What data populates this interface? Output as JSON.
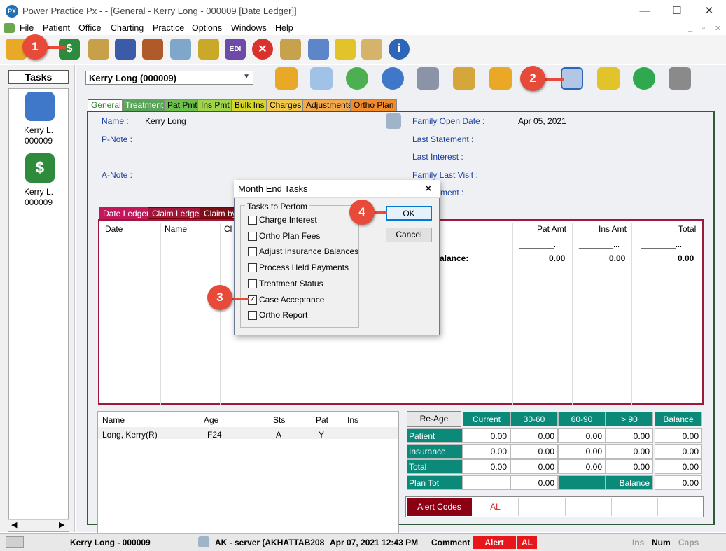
{
  "window": {
    "title": "Power Practice Px -  - [General - Kerry Long - 000009 [Date Ledger]]",
    "logo": "PX",
    "minimize": "—",
    "maximize": "☐",
    "close": "✕"
  },
  "menu": {
    "items": [
      "File",
      "Patient",
      "Office",
      "Charting",
      "Practice",
      "Options",
      "Windows",
      "Help"
    ],
    "mdi_controls": [
      "_",
      "▫",
      "✕"
    ]
  },
  "toolbar": {
    "icons": [
      "folder-open-icon",
      "money-refresh-icon",
      "pencil-icon",
      "book-icon",
      "calendar-grid-icon",
      "chart-icon",
      "gift-box-icon",
      "edi-icon",
      "stop-icon",
      "clipboard-icon",
      "medicine-icon",
      "tooth-icon",
      "notes-icon",
      "info-icon"
    ],
    "edi_label": "EDI"
  },
  "tasks": {
    "title": "Tasks",
    "items": [
      {
        "name": "Kerry L.",
        "id": "000009"
      },
      {
        "name": "Kerry L.",
        "id": "000009"
      }
    ]
  },
  "patient": {
    "selected": "Kerry Long (000009)"
  },
  "tabs": [
    "General",
    "Treatment",
    "Pat Pmt",
    "Ins Pmt",
    "Bulk Ins",
    "Charges",
    "Adjustments",
    "Ortho Plan"
  ],
  "general": {
    "name_label": "Name :",
    "name_value": "Kerry Long",
    "pnote_label": "P-Note :",
    "anote_label": "A-Note :",
    "family_open_label": "Family Open Date :",
    "family_open_value": "Apr 05, 2021",
    "last_statement_label": "Last Statement :",
    "last_interest_label": "Last Interest :",
    "family_last_visit_label": "Family Last Visit :",
    "last_payment_partial": "ment :"
  },
  "ledger_tabs": [
    "Date Ledger",
    "Claim Ledger",
    "Claim by"
  ],
  "ledger": {
    "headers": [
      "Date",
      "Name",
      "Cl",
      "Pat Amt",
      "Ins Amt",
      "Total"
    ],
    "dashes": "________...",
    "balance_label": "alance:",
    "pat_balance": "0.00",
    "ins_balance": "0.00",
    "total_balance": "0.00"
  },
  "family": {
    "headers": [
      "Name",
      "Age",
      "Sts",
      "Pat",
      "Ins"
    ],
    "rows": [
      {
        "name": "Long, Kerry(R)",
        "age": "F24",
        "sts": "A",
        "pat": "Y",
        "ins": ""
      }
    ]
  },
  "aging": {
    "reage": "Re-Age",
    "headers": [
      "Current",
      "30-60",
      "60-90",
      "> 90",
      "Balance"
    ],
    "rows": [
      {
        "label": "Patient",
        "values": [
          "0.00",
          "0.00",
          "0.00",
          "0.00",
          "0.00"
        ]
      },
      {
        "label": "Insurance",
        "values": [
          "0.00",
          "0.00",
          "0.00",
          "0.00",
          "0.00"
        ]
      },
      {
        "label": "Total",
        "values": [
          "0.00",
          "0.00",
          "0.00",
          "0.00",
          "0.00"
        ]
      }
    ],
    "plan_tot_label": "Plan Tot",
    "plan_tot_value": "0.00",
    "balance_label": "Balance",
    "balance_value": "0.00"
  },
  "alerts": {
    "label": "Alert Codes",
    "code": "AL"
  },
  "status": {
    "patient": "Kerry Long - 000009",
    "server": "AK - server (AKHATTAB208",
    "datetime": "Apr 07, 2021 12:43 PM",
    "comment": "Comment",
    "alert": "Alert",
    "al": "AL",
    "ins": "Ins",
    "num": "Num",
    "caps": "Caps"
  },
  "dialog": {
    "title": "Month End Tasks",
    "close": "✕",
    "group_label": "Tasks to Perfom",
    "tasks": [
      {
        "label": "Charge Interest",
        "checked": false
      },
      {
        "label": "Ortho Plan Fees",
        "checked": false
      },
      {
        "label": "Adjust Insurance Balances",
        "checked": false
      },
      {
        "label": "Process Held Payments",
        "checked": false
      },
      {
        "label": "Treatment Status",
        "checked": false
      },
      {
        "label": "Case Acceptance",
        "checked": true
      },
      {
        "label": "Ortho Report",
        "checked": false
      }
    ],
    "ok": "OK",
    "cancel": "Cancel",
    "check_mark": "✓"
  },
  "callouts": [
    "1",
    "2",
    "3",
    "4"
  ],
  "colors": {
    "accent_red": "#e84a3a",
    "teal": "#0b8a7a",
    "ledger_border": "#a0173b",
    "frame_green": "#2f5b3b"
  }
}
